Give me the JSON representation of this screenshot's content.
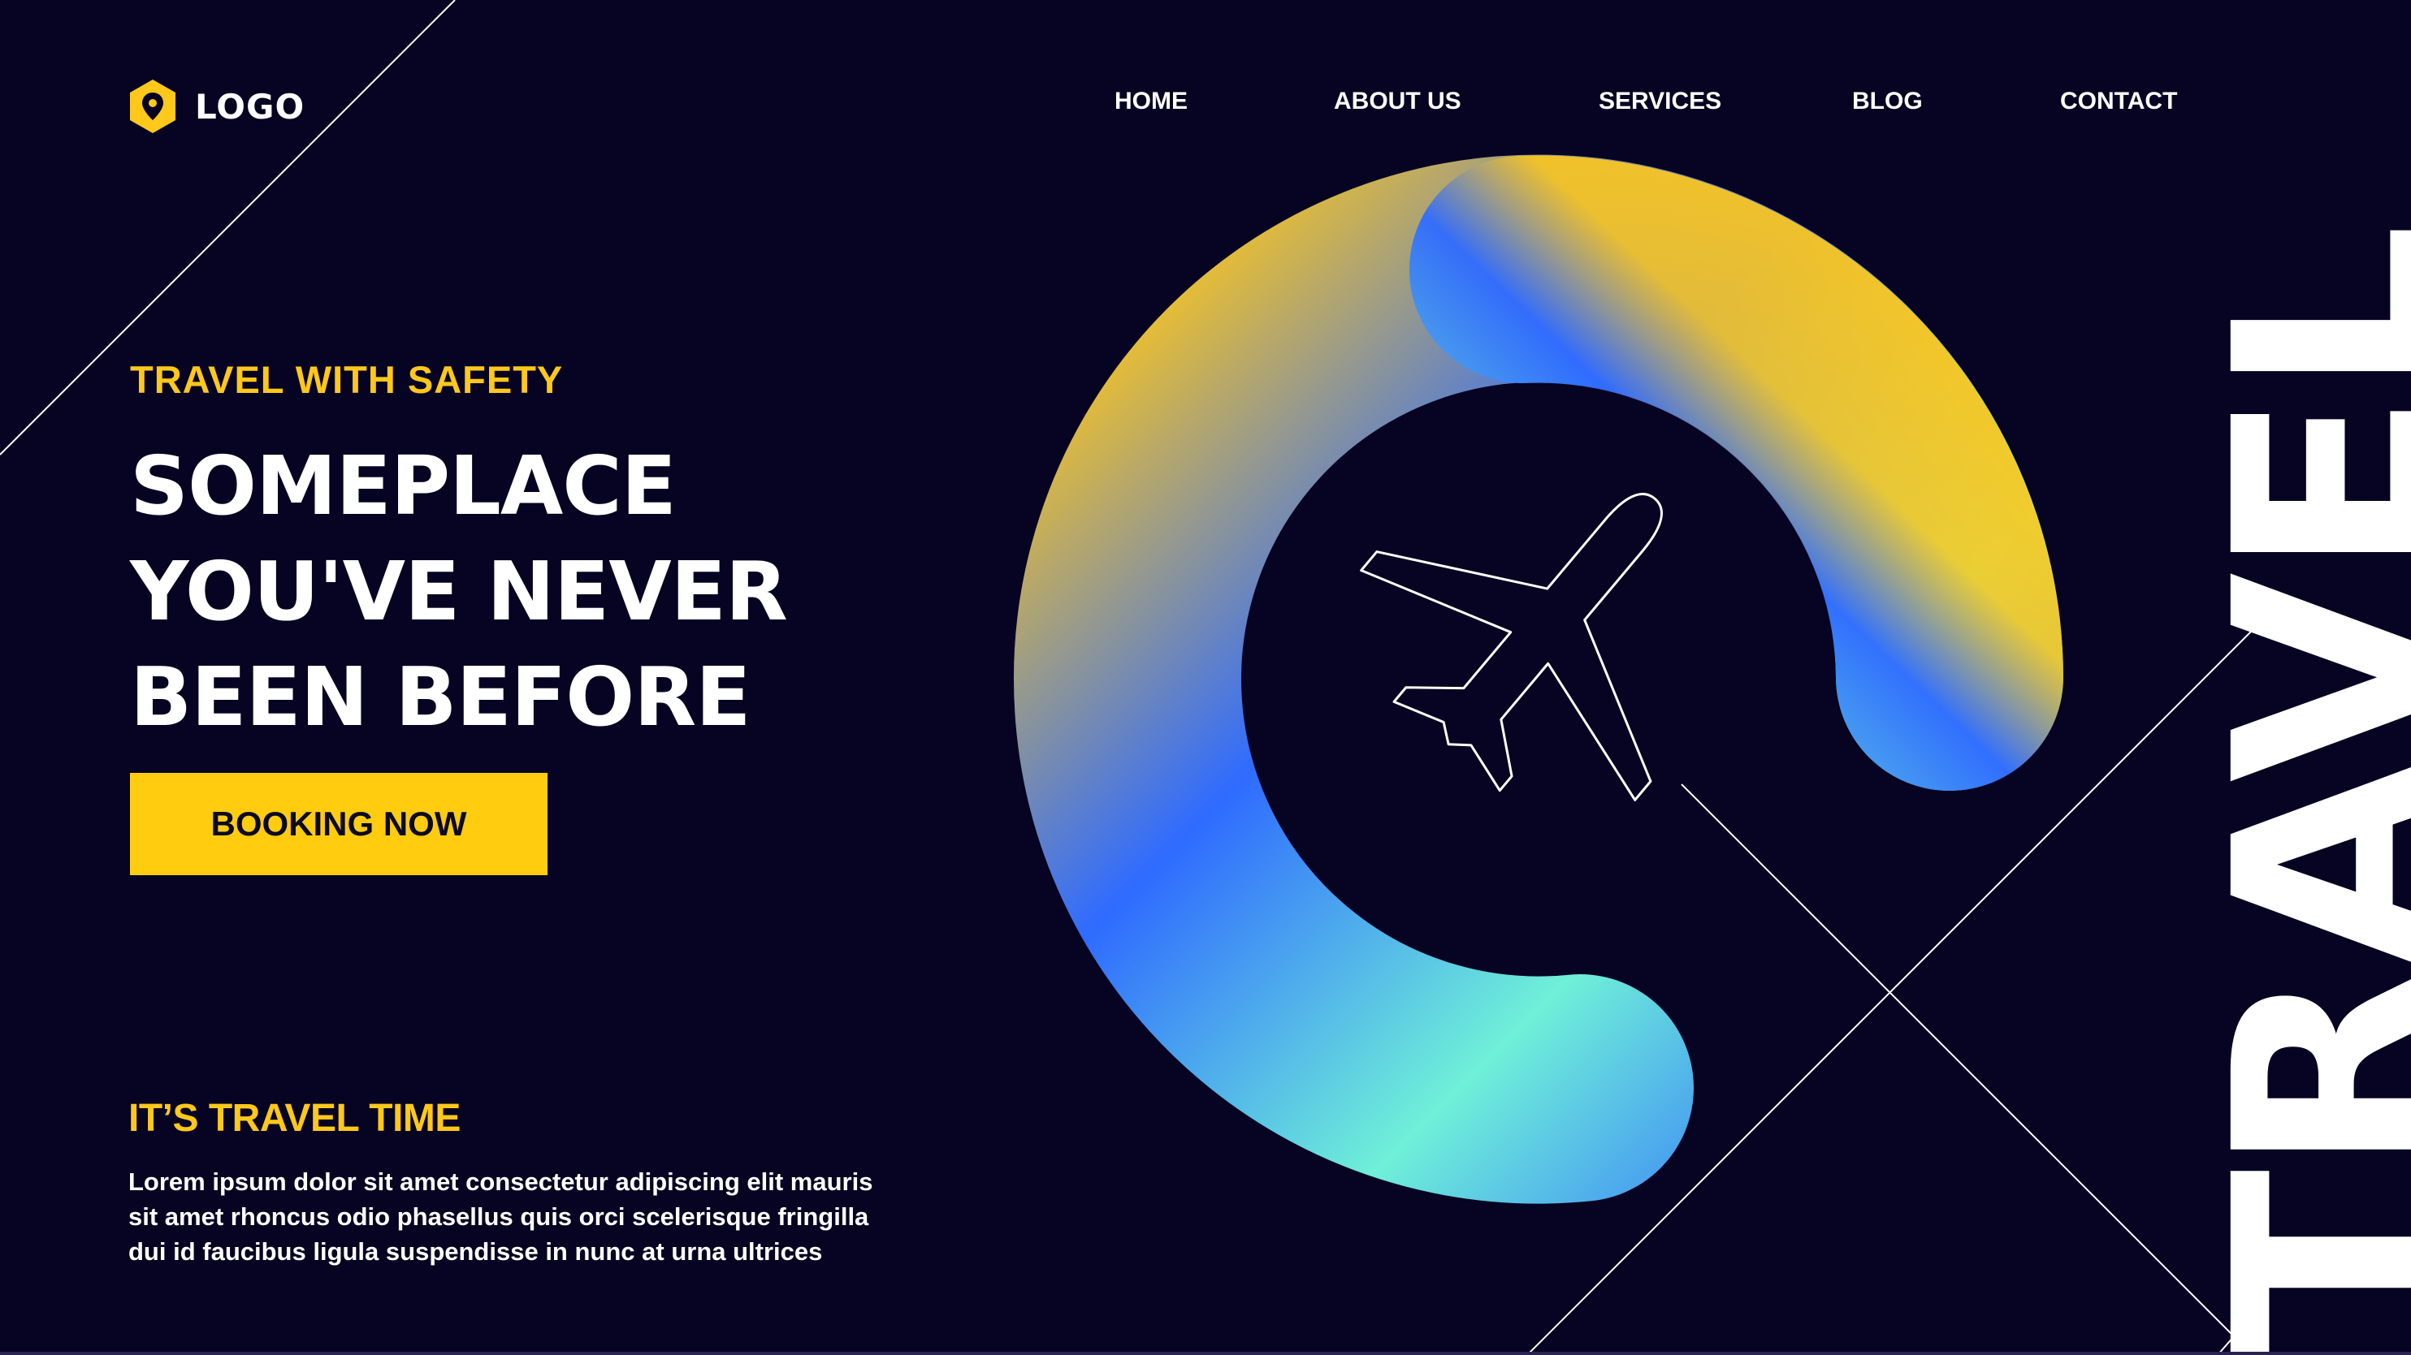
{
  "brand": {
    "logo_text": "LOGO",
    "logo_icon": "map-pin-icon",
    "accent": "#ffc81a",
    "background": "#070322"
  },
  "nav": {
    "items": [
      "HOME",
      "ABOUT US",
      "SERVICES",
      "BLOG",
      "CONTACT"
    ]
  },
  "hero": {
    "eyebrow": "TRAVEL WITH SAFETY",
    "headline": [
      "SOMEPLACE",
      "YOU'VE NEVER",
      "BEEN BEFORE"
    ],
    "cta_label": "BOOKING NOW",
    "cta_color": "#ffcc10"
  },
  "info": {
    "title": "IT’S TRAVEL TIME",
    "body": "Lorem ipsum dolor sit amet consectetur adipiscing elit mauris sit amet rhoncus odio phasellus quis orci scelerisque fringilla dui id faucibus ligula suspendisse in nunc at urna ultrices"
  },
  "side_word": "TRAVEL",
  "graphic": {
    "icon": "airplane-icon",
    "gradient": [
      "#ffc81a",
      "#2f6bff",
      "#6ff0d8"
    ]
  }
}
